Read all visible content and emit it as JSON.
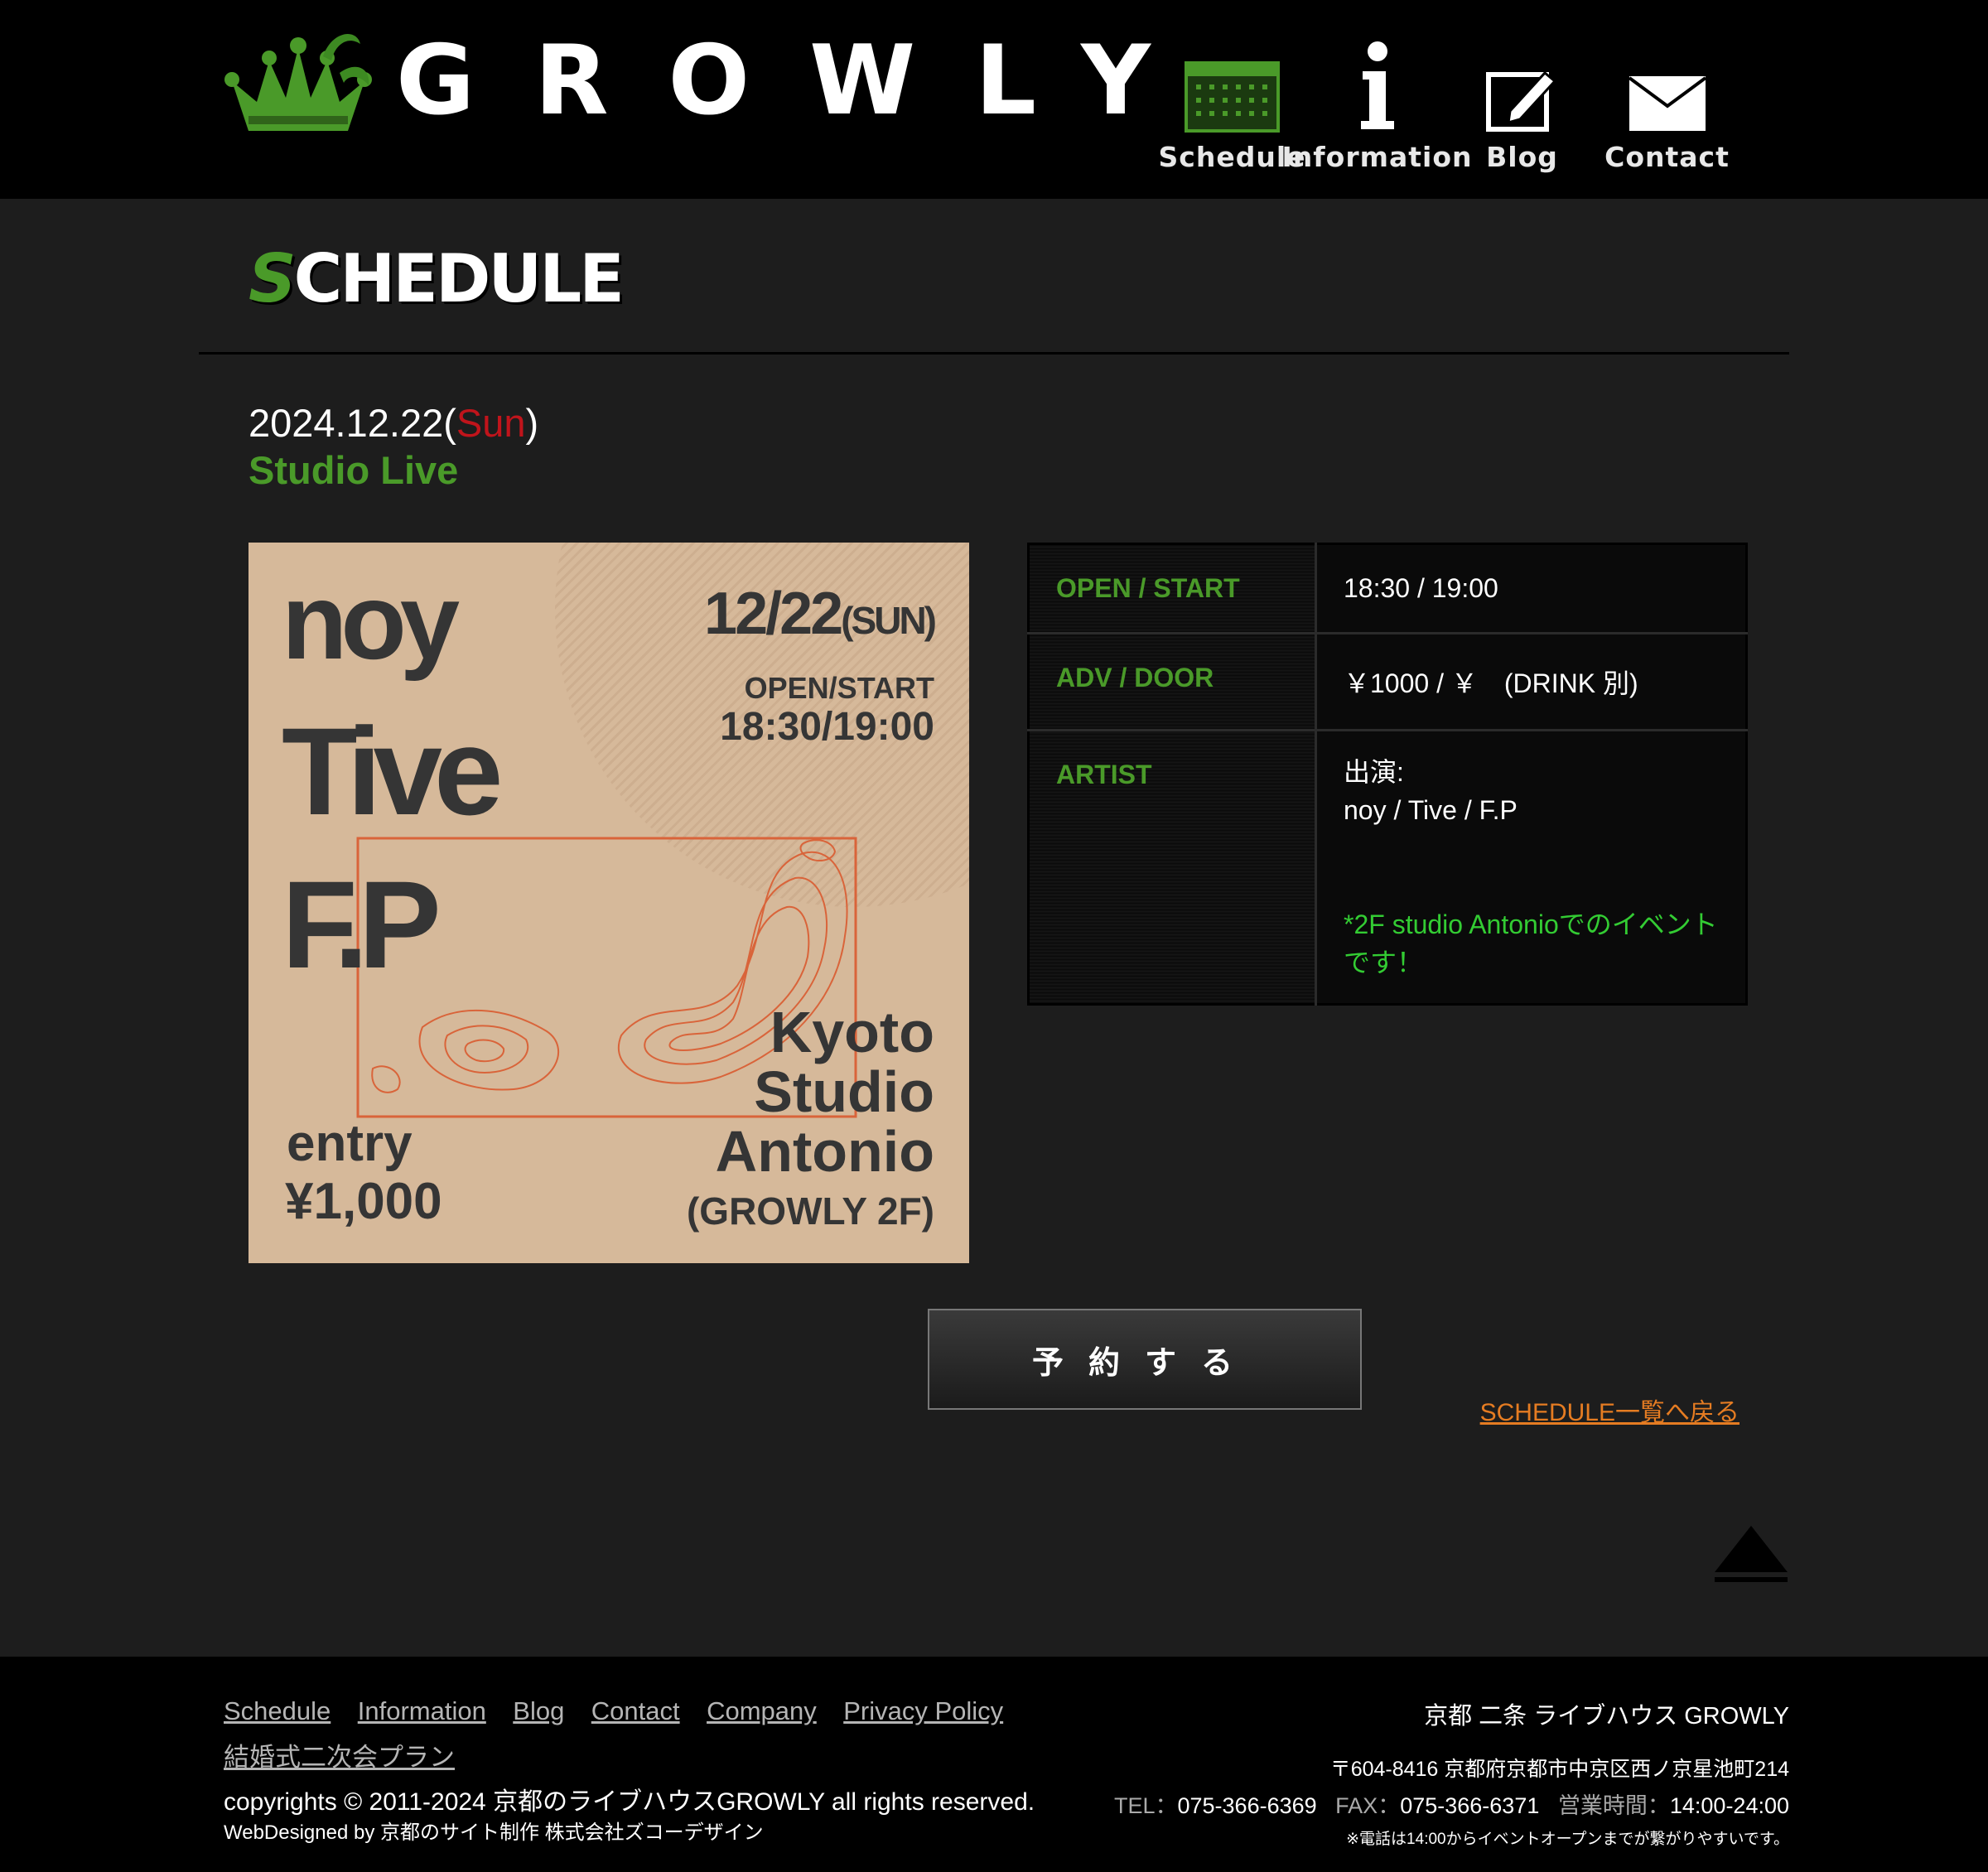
{
  "header": {
    "logo_text": "GROWLY",
    "nav": [
      {
        "label": "Schedule",
        "icon": "calendar-icon"
      },
      {
        "label": "Information",
        "icon": "info-icon"
      },
      {
        "label": "Blog",
        "icon": "edit-icon"
      },
      {
        "label": "Contact",
        "icon": "mail-icon"
      }
    ]
  },
  "section": {
    "title_first": "S",
    "title_rest": "CHEDULE"
  },
  "event": {
    "date": "2024.12.22(",
    "day_of_week": "Sun",
    "date_close": ")",
    "venue": "Studio Live",
    "flyer": {
      "artists": [
        "noy",
        "Tive",
        "F.P"
      ],
      "date": "12/22",
      "dow": "(SUN)",
      "open_start_label": "OPEN/START",
      "open_start_time": "18:30/19:00",
      "location_lines": [
        "Kyoto",
        "Studio",
        "Antonio",
        "(GROWLY 2F)"
      ],
      "entry_label": "entry",
      "entry_price": "¥1,000"
    },
    "info": {
      "open_start_label": "OPEN / START",
      "open_start_value": "18:30 / 19:00",
      "price_label": "ADV / DOOR",
      "price_value": "￥1000 / ￥　(DRINK 別)",
      "artist_label": "ARTIST",
      "artist_heading": "出演:",
      "artist_value": "noy / Tive / F.P",
      "note": "*2F studio Antonioでのイベントです！"
    },
    "reserve_button": "予約する",
    "back_link": "SCHEDULE一覧へ戻る"
  },
  "footer": {
    "links": [
      "Schedule",
      "Information",
      "Blog",
      "Contact",
      "Company",
      "Privacy Policy",
      "結婚式二次会プラン"
    ],
    "copyright": "copyrights © 2011-2024 京都のライブハウスGROWLY all rights reserved.",
    "webdesigned": "WebDesigned by 京都のサイト制作 株式会社ズコーデザイン",
    "venue_name": "京都 二条 ライブハウス GROWLY",
    "address": "〒604-8416 京都府京都市中京区西ノ京星池町214",
    "tel_label": "TEL：",
    "tel": "075-366-6369",
    "fax_label": "FAX：",
    "fax": "075-366-6371",
    "hours_label": "営業時間：",
    "hours": "14:00-24:00",
    "note": "※電話は14:00からイベントオープンまでが繋がりやすいです。"
  },
  "colors": {
    "accent_green": "#4a9a29",
    "sunday_red": "#c0141b",
    "link_orange": "#e57c22",
    "note_green": "#33cc33"
  }
}
